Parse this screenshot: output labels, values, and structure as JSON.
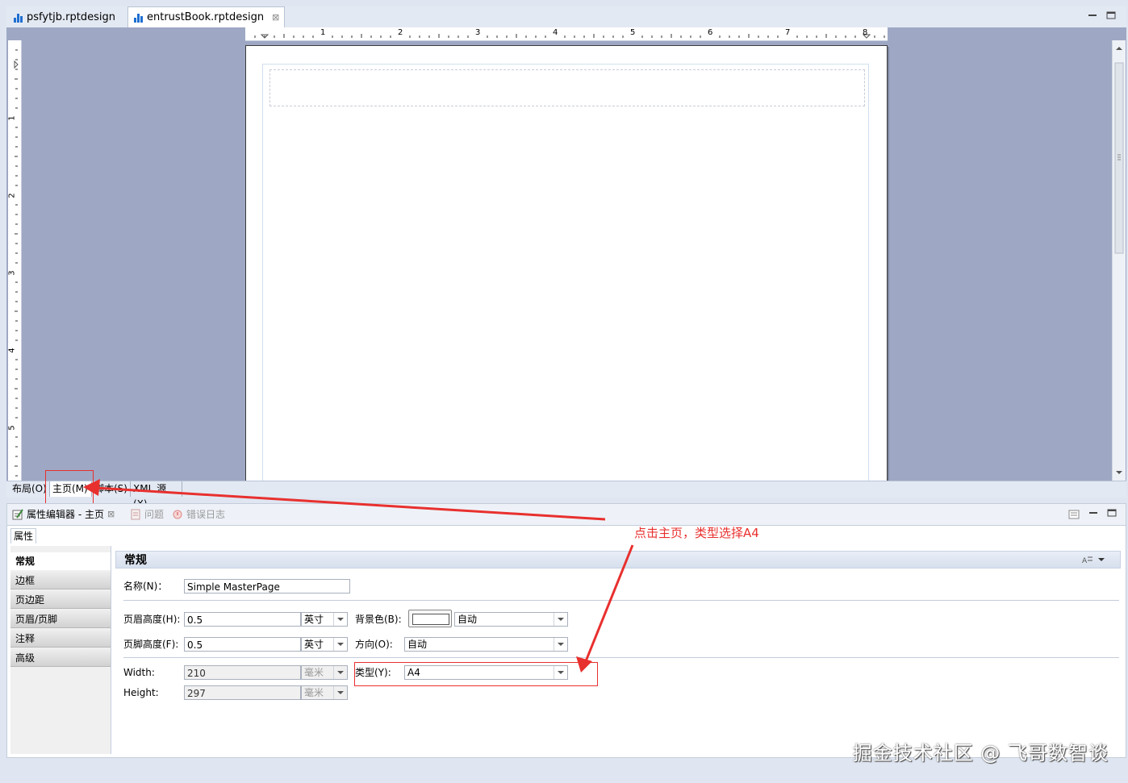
{
  "editor": {
    "tabs": [
      {
        "label": "psfytjb.rptdesign"
      },
      {
        "label": "entrustBook.rptdesign"
      }
    ],
    "close_glyph": "⊠"
  },
  "ruler": {
    "h_numbers": [
      "1",
      "2",
      "3",
      "4",
      "5",
      "6",
      "7",
      "8"
    ],
    "v_numbers": [
      "1",
      "2",
      "3",
      "4",
      "5"
    ]
  },
  "bottom_tabs": [
    "布局(O)",
    "主页(M)",
    "脚本(S)",
    "XML 源(X)"
  ],
  "view": {
    "tabs": [
      {
        "label": "属性编辑器 - 主页"
      },
      {
        "label": "问题"
      },
      {
        "label": "错误日志"
      }
    ],
    "subtab": "属性"
  },
  "sidebar": {
    "items": [
      {
        "label": "常规"
      },
      {
        "label": "边框"
      },
      {
        "label": "页边距"
      },
      {
        "label": "页眉/页脚"
      },
      {
        "label": "注释"
      },
      {
        "label": "高级"
      }
    ]
  },
  "panel": {
    "title": "常规",
    "name_label": "名称(N)：",
    "name_value": "Simple MasterPage",
    "header_height_label": "页眉高度(H):",
    "header_height_value": "0.5",
    "header_height_unit": "英寸",
    "footer_height_label": "页脚高度(F):",
    "footer_height_value": "0.5",
    "footer_height_unit": "英寸",
    "bg_color_label": "背景色(B):",
    "bg_color_value": "自动",
    "orientation_label": "方向(O):",
    "orientation_value": "自动",
    "width_label": "Width:",
    "width_value": "210",
    "width_unit": "毫米",
    "height_label": "Height:",
    "height_value": "297",
    "height_unit": "毫米",
    "type_label": "类型(Y):",
    "type_value": "A4"
  },
  "annotation": "点击主页，类型选择A4",
  "watermark": "掘金技术社区 @ 飞哥数智谈",
  "colors": {
    "design_bg": "#9ea8c4",
    "annotation_red": "#e8302e",
    "file_icon_blue": "#1f6fd1"
  }
}
